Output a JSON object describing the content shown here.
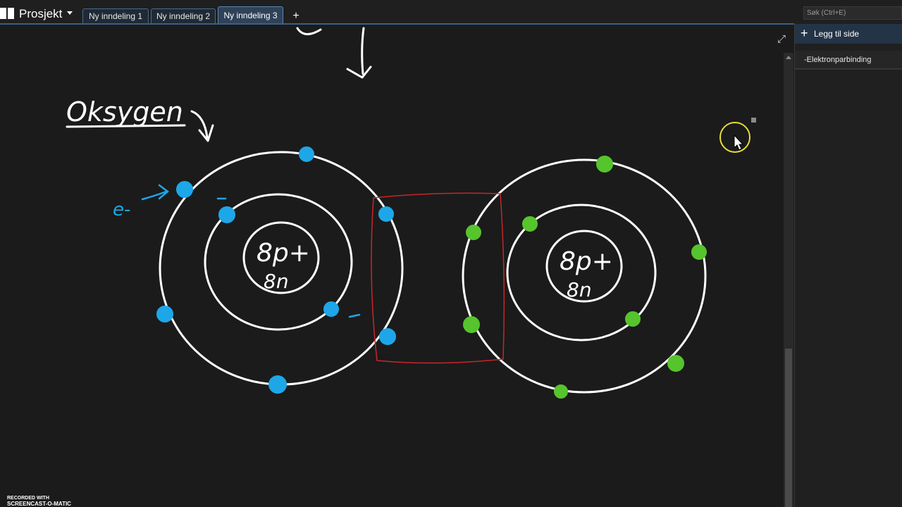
{
  "app": {
    "notebook_title": "Prosjekt",
    "search_placeholder": "Søk (Ctrl+E)"
  },
  "tabs": [
    {
      "label": "Ny inndeling 1",
      "active": false
    },
    {
      "label": "Ny inndeling 2",
      "active": false
    },
    {
      "label": "Ny inndeling 3",
      "active": true
    }
  ],
  "pages_panel": {
    "add_page_label": "Legg til side",
    "pages": [
      {
        "title": "-Elektronparbinding",
        "selected": true
      }
    ]
  },
  "canvas": {
    "heading_ink": "Oksygen",
    "electron_label_ink": "e-",
    "atoms": [
      {
        "protons": "8p+",
        "neutrons": "8n",
        "ink_color": "#1ea7e8"
      },
      {
        "protons": "8p+",
        "neutrons": "8n",
        "ink_color": "#56c42c"
      }
    ],
    "bond_box_color": "#c8262a"
  },
  "watermark": {
    "line1": "RECORDED WITH",
    "line2": "SCREENCAST-O-MATIC"
  },
  "colors": {
    "tab_active": "#2f4258",
    "accent": "#3a5f86",
    "ink_white": "#ffffff",
    "cursor_highlight": "#e8dc3a"
  }
}
